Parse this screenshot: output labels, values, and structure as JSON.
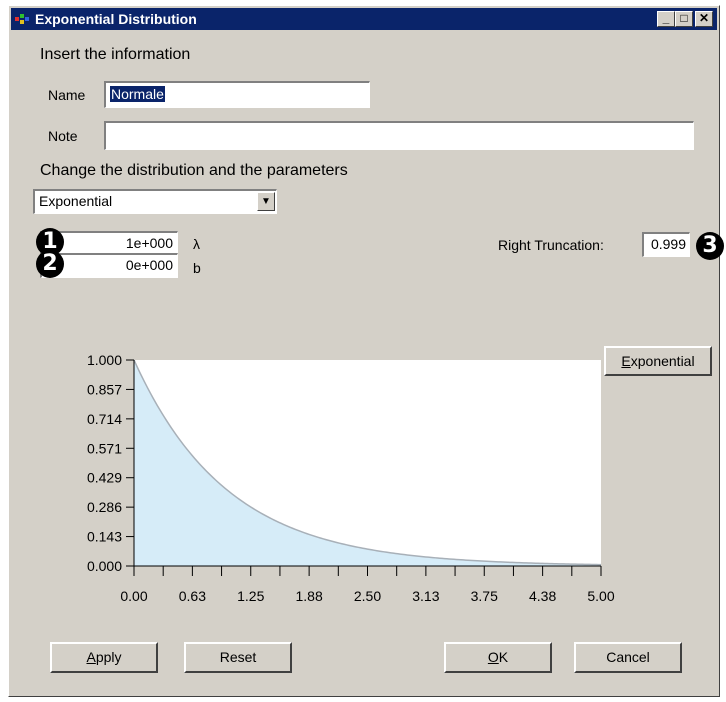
{
  "window": {
    "title": "Exponential Distribution"
  },
  "info": {
    "heading": "Insert the information",
    "name_label": "Name",
    "name_value": "Normale",
    "note_label": "Note",
    "note_value": ""
  },
  "distribution": {
    "heading": "Change the distribution and the parameters",
    "selected": "Exponential"
  },
  "params": {
    "lambda_value": "1e+000",
    "lambda_symbol": "λ",
    "b_value": "0e+000",
    "b_symbol": "b",
    "right_truncation_label": "Right Truncation:",
    "right_truncation_value": "0.999"
  },
  "markers": [
    "1",
    "2",
    "3"
  ],
  "chart_button": {
    "label_underlined": "E",
    "label_rest": "xponential"
  },
  "buttons": {
    "apply_u": "A",
    "apply_rest": "pply",
    "reset": "Reset",
    "ok_u": "O",
    "ok_rest": "K",
    "cancel": "Cancel"
  },
  "colors": {
    "titlebar": "#0a246a",
    "face": "#d4d0c8",
    "curve_fill": "#d6ecf8",
    "curve_line": "#a8b0b8"
  },
  "chart_data": {
    "type": "area",
    "x_ticks": [
      "0.00",
      "0.63",
      "1.25",
      "1.88",
      "2.50",
      "3.13",
      "3.75",
      "4.38",
      "5.00"
    ],
    "y_ticks": [
      "1.000",
      "0.857",
      "0.714",
      "0.571",
      "0.429",
      "0.286",
      "0.143",
      "0.000"
    ],
    "xlim": [
      0,
      5
    ],
    "ylim": [
      0,
      1
    ],
    "function": "exp(-x)"
  }
}
